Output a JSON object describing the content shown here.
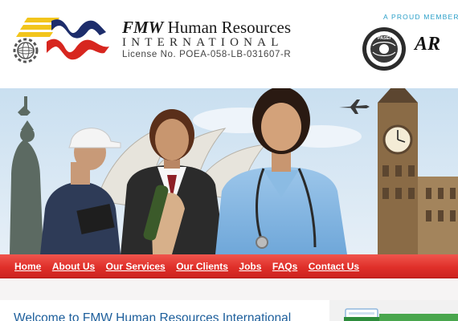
{
  "header": {
    "brand_mark": "FMW",
    "title_rest": "Human Resources",
    "subtitle": "INTERNATIONAL",
    "license": "License No. POEA-058-LB-031607-R",
    "proud_member": "A PROUD MEMBERS",
    "seal_label": "PASEI",
    "partner_logo": "AR"
  },
  "colors": {
    "nav_red": "#e0302a",
    "brand_blue": "#1c5e9b",
    "accent_cyan": "#2a9fc8",
    "logo_yellow": "#f2c51c",
    "logo_red": "#d7261f",
    "logo_navy": "#1d2d6b"
  },
  "nav": {
    "items": [
      {
        "label": "Home"
      },
      {
        "label": "About Us"
      },
      {
        "label": "Our Services"
      },
      {
        "label": "Our Clients"
      },
      {
        "label": "Jobs"
      },
      {
        "label": "FAQs"
      },
      {
        "label": "Contact Us"
      }
    ]
  },
  "main": {
    "welcome_title": "Welcome to FMW Human Resources International"
  }
}
